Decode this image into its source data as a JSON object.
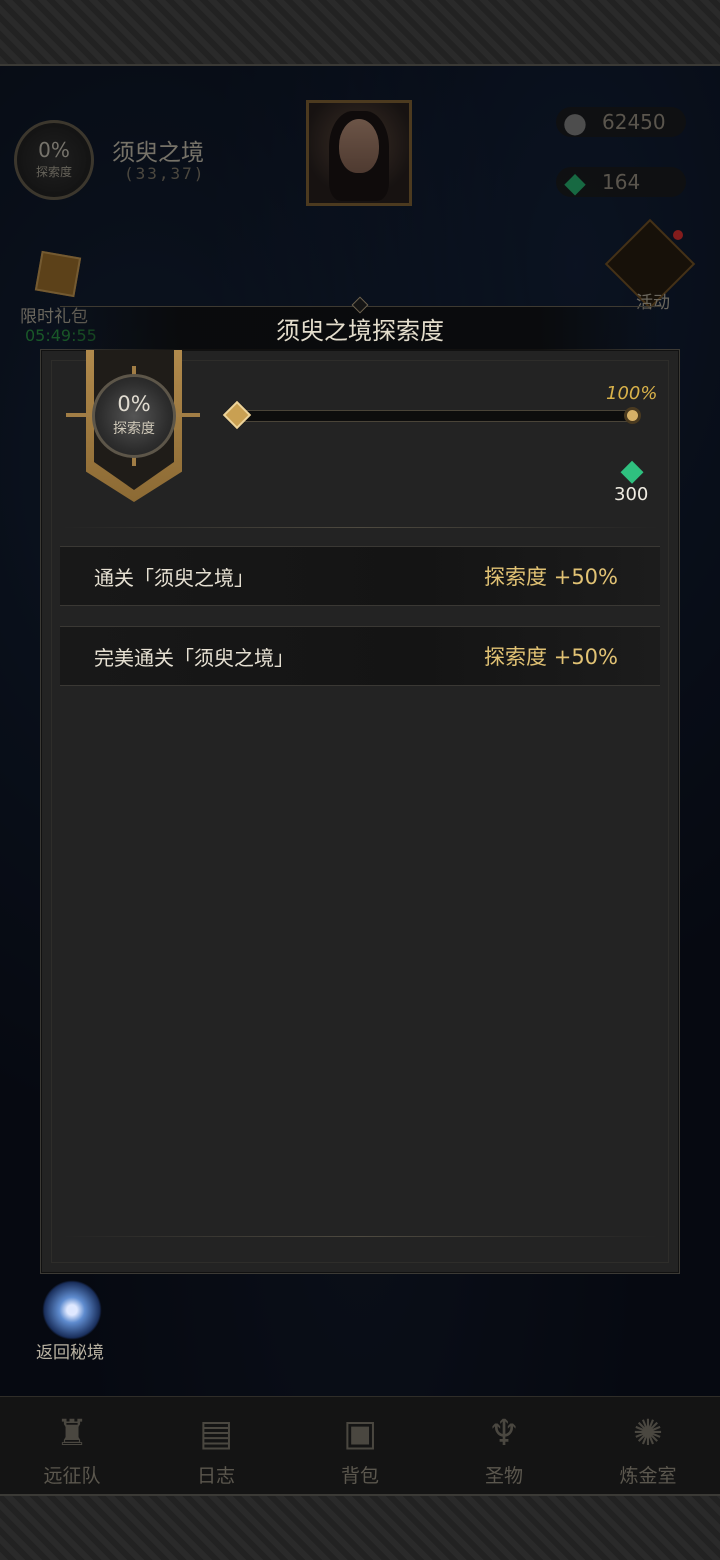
{
  "hud": {
    "exploration_percent": "0%",
    "exploration_label": "探索度",
    "region_name": "须臾之境",
    "coordinates": "(33,37)",
    "stone_count": "62450",
    "gem_count": "164"
  },
  "side": {
    "gift_label": "限时礼包",
    "gift_timer": "05:49:55",
    "event_label": "活动",
    "return_label": "返回秘境"
  },
  "nav": {
    "items": [
      {
        "label": "远征队",
        "icon": "horned-helmet-icon"
      },
      {
        "label": "日志",
        "icon": "scroll-icon"
      },
      {
        "label": "背包",
        "icon": "backpack-icon"
      },
      {
        "label": "圣物",
        "icon": "relic-icon"
      },
      {
        "label": "炼金室",
        "icon": "alchemy-icon"
      }
    ]
  },
  "dialog": {
    "title": "须臾之境探索度",
    "exploration_percent": "0%",
    "exploration_label": "探索度",
    "progress": 0,
    "progress_max_label": "100%",
    "reward_icon": "green-gem-icon",
    "reward_count": "300",
    "tasks": [
      {
        "text": "通关「须臾之境」",
        "value": "探索度 +50%"
      },
      {
        "text": "完美通关「须臾之境」",
        "value": "探索度 +50%"
      }
    ]
  },
  "colors": {
    "accent_gold": "#caa35a",
    "timer_green": "#2fa04a",
    "gem_green": "#2fc07f",
    "value_gold": "#e1c274"
  }
}
